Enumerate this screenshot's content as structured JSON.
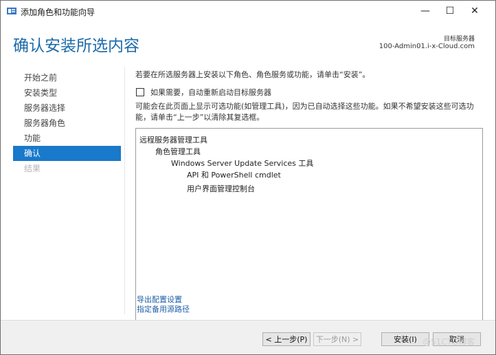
{
  "window": {
    "title": "添加角色和功能向导",
    "minimize_glyph": "—",
    "maximize_glyph": "☐",
    "close_glyph": "✕"
  },
  "header": {
    "page_title": "确认安装所选内容",
    "target_label": "目标服务器",
    "target_value": "100-Admin01.i-x-Cloud.com"
  },
  "nav": {
    "items": [
      {
        "label": "开始之前",
        "state": "normal"
      },
      {
        "label": "安装类型",
        "state": "normal"
      },
      {
        "label": "服务器选择",
        "state": "normal"
      },
      {
        "label": "服务器角色",
        "state": "normal"
      },
      {
        "label": "功能",
        "state": "normal"
      },
      {
        "label": "确认",
        "state": "active"
      },
      {
        "label": "结果",
        "state": "disabled"
      }
    ]
  },
  "content": {
    "instruction": "若要在所选服务器上安装以下角色、角色服务或功能，请单击“安装”。",
    "restart_checkbox": {
      "label": "如果需要，自动重新启动目标服务器",
      "checked": false
    },
    "note": "可能会在此页面上显示可选功能(如管理工具)，因为已自动选择这些功能。如果不希望安装这些可选功能，请单击“上一步”以清除其复选框。",
    "tree": [
      {
        "label": "远程服务器管理工具",
        "level": 0
      },
      {
        "label": "角色管理工具",
        "level": 1
      },
      {
        "label": "Windows Server Update Services 工具",
        "level": 2
      },
      {
        "label": "API 和 PowerShell cmdlet",
        "level": 3
      },
      {
        "label": "用户界面管理控制台",
        "level": 3
      }
    ],
    "links": {
      "export": "导出配置设置",
      "alternate_source": "指定备用源路径"
    }
  },
  "footer": {
    "prev": "< 上一步(P)",
    "next": "下一步(N) >",
    "install": "安装(I)",
    "cancel": "取消"
  },
  "watermark": "@51CTO博客",
  "colors": {
    "accent": "#1979ca",
    "title": "#1c6aa8",
    "link": "#1f5fa8"
  }
}
